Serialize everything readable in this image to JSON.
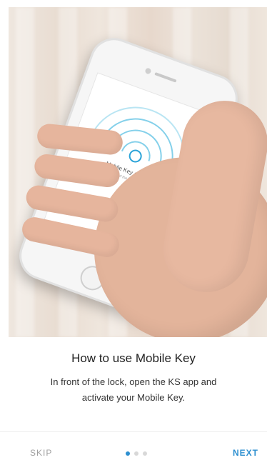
{
  "hero": {
    "screen_text": "Mobile Key active",
    "screen_subtext": "Tap the unlock of the lock with Mobile Key"
  },
  "onboarding": {
    "title": "How to use Mobile Key",
    "description": "In front of the lock, open the KS app and activate your Mobile Key."
  },
  "pager": {
    "total": 3,
    "active_index": 0,
    "active_color": "#2d8fd0",
    "inactive_color": "#d8d8d8"
  },
  "actions": {
    "skip_label": "SKIP",
    "next_label": "NEXT",
    "next_color": "#2d8fd0"
  }
}
